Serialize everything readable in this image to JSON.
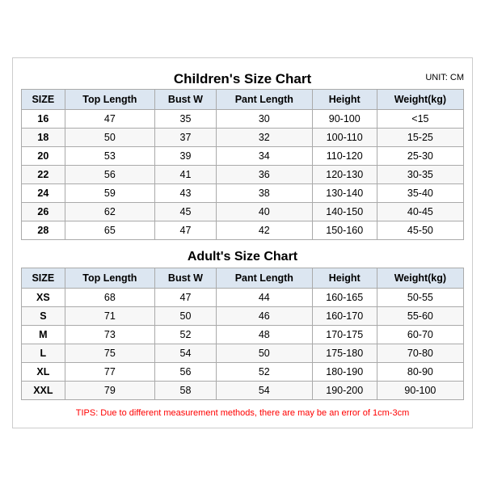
{
  "mainTitle": "Children's Size Chart",
  "unitLabel": "UNIT: CM",
  "childHeaders": [
    "SIZE",
    "Top Length",
    "Bust W",
    "Pant Length",
    "Height",
    "Weight(kg)"
  ],
  "childRows": [
    [
      "16",
      "47",
      "35",
      "30",
      "90-100",
      "<15"
    ],
    [
      "18",
      "50",
      "37",
      "32",
      "100-110",
      "15-25"
    ],
    [
      "20",
      "53",
      "39",
      "34",
      "110-120",
      "25-30"
    ],
    [
      "22",
      "56",
      "41",
      "36",
      "120-130",
      "30-35"
    ],
    [
      "24",
      "59",
      "43",
      "38",
      "130-140",
      "35-40"
    ],
    [
      "26",
      "62",
      "45",
      "40",
      "140-150",
      "40-45"
    ],
    [
      "28",
      "65",
      "47",
      "42",
      "150-160",
      "45-50"
    ]
  ],
  "adultTitle": "Adult's Size Chart",
  "adultHeaders": [
    "SIZE",
    "Top Length",
    "Bust W",
    "Pant Length",
    "Height",
    "Weight(kg)"
  ],
  "adultRows": [
    [
      "XS",
      "68",
      "47",
      "44",
      "160-165",
      "50-55"
    ],
    [
      "S",
      "71",
      "50",
      "46",
      "160-170",
      "55-60"
    ],
    [
      "M",
      "73",
      "52",
      "48",
      "170-175",
      "60-70"
    ],
    [
      "L",
      "75",
      "54",
      "50",
      "175-180",
      "70-80"
    ],
    [
      "XL",
      "77",
      "56",
      "52",
      "180-190",
      "80-90"
    ],
    [
      "XXL",
      "79",
      "58",
      "54",
      "190-200",
      "90-100"
    ]
  ],
  "tips": "TIPS: Due to different measurement methods, there are may be an error of 1cm-3cm"
}
